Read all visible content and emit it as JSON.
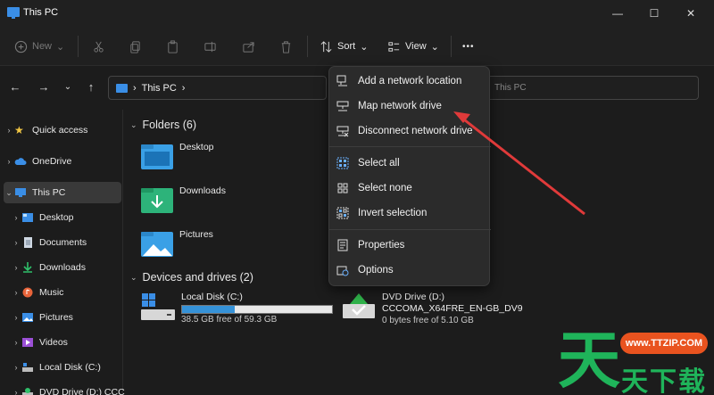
{
  "window": {
    "title": "This PC",
    "minimize": "—",
    "maximize": "☐",
    "close": "✕"
  },
  "toolbar": {
    "new_label": "New",
    "sort_label": "Sort",
    "view_label": "View",
    "more_label": "•••"
  },
  "address": {
    "location": "This PC",
    "search_placeholder": "This PC"
  },
  "sidebar": {
    "items": [
      {
        "label": "Quick access",
        "icon": "star-icon"
      },
      {
        "label": "OneDrive",
        "icon": "cloud-icon"
      },
      {
        "label": "This PC",
        "icon": "pc-icon"
      },
      {
        "label": "Desktop",
        "icon": "desktop-icon"
      },
      {
        "label": "Documents",
        "icon": "documents-icon"
      },
      {
        "label": "Downloads",
        "icon": "download-icon"
      },
      {
        "label": "Music",
        "icon": "music-icon"
      },
      {
        "label": "Pictures",
        "icon": "pictures-icon"
      },
      {
        "label": "Videos",
        "icon": "videos-icon"
      },
      {
        "label": "Local Disk (C:)",
        "icon": "disk-icon"
      },
      {
        "label": "DVD Drive (D:) CCC",
        "icon": "dvd-icon"
      }
    ]
  },
  "main": {
    "folders_header": "Folders (6)",
    "folders": [
      "Desktop",
      "Downloads",
      "Pictures"
    ],
    "drives_header": "Devices and drives (2)",
    "drives": [
      {
        "name": "Local Disk (C:)",
        "free": "38.5 GB free of 59.3 GB",
        "used_fraction": 0.35
      },
      {
        "name": "DVD Drive (D:)",
        "volume": "CCCOMA_X64FRE_EN-GB_DV9",
        "free": "0 bytes free of 5.10 GB"
      }
    ]
  },
  "menu": {
    "items": [
      "Add a network location",
      "Map network drive",
      "Disconnect network drive",
      "Select all",
      "Select none",
      "Invert selection",
      "Properties",
      "Options"
    ]
  },
  "watermark": {
    "big": "天",
    "url": "www.TTZIP.COM",
    "sub": "天下载"
  },
  "colors": {
    "accent": "#3592d8",
    "arrow": "#e03a3a",
    "logo_green": "#1fb45a",
    "logo_orange": "#e9531f"
  }
}
